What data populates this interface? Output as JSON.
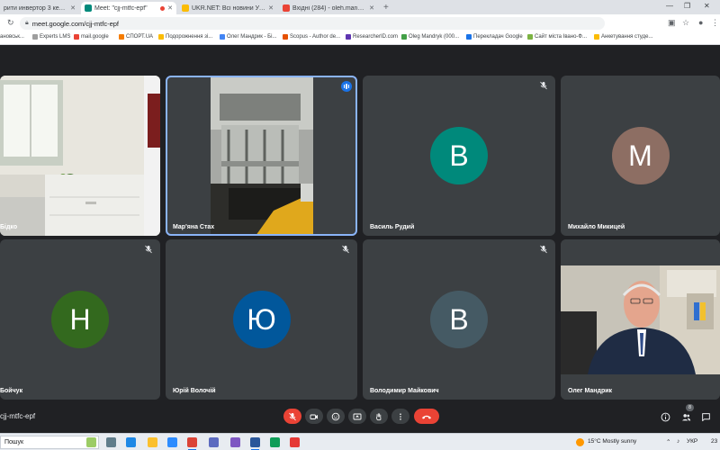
{
  "browser": {
    "tabs": [
      {
        "label": "рити инвертор 3 кет в Івано-Ф",
        "fav_color": "#4285f4"
      },
      {
        "label": "Meet: \"cjj-mtfc-epf\"",
        "fav_color": "#00897b"
      },
      {
        "label": "UKR.NET: Всі новини України, о",
        "fav_color": "#fbbc04"
      },
      {
        "label": "Вхідні (284) - oleh.mandryk@nu",
        "fav_color": "#ea4335"
      }
    ],
    "url": "meet.google.com/cjj-mtfc-epf",
    "bookmarks": [
      {
        "label": "ановськ...",
        "color": "#9e9e9e"
      },
      {
        "label": "Experts LMS",
        "color": "#ffffff"
      },
      {
        "label": "mail.google",
        "color": "#ea4335"
      },
      {
        "label": "СПОРТ.UA",
        "color": "#f57c00"
      },
      {
        "label": "Подорожнення зі...",
        "color": "#fbbc04"
      },
      {
        "label": "Олег Мандрик - Бі...",
        "color": "#4285f4"
      },
      {
        "label": "Scopus - Author de...",
        "color": "#e65100"
      },
      {
        "label": "ResearcherID.com",
        "color": "#5e35b1"
      },
      {
        "label": "Oleg Mandryk (000...",
        "color": "#43a047"
      },
      {
        "label": "Перекладач Google",
        "color": "#1a73e8"
      },
      {
        "label": "Сайт міста Івано-Ф...",
        "color": "#7cb342"
      },
      {
        "label": "Анкетування студе...",
        "color": "#fbbc04"
      }
    ]
  },
  "participants": [
    {
      "name": "Бідко",
      "type": "video-office"
    },
    {
      "name": "Мар'яна Стах",
      "type": "video-equipment",
      "speaking": true
    },
    {
      "name": "Василь Рудий",
      "initial": "В",
      "color": "#00897b"
    },
    {
      "name": "Михайло Микицей",
      "initial": "М",
      "color": "#8d6e63"
    },
    {
      "name": "Бойчук",
      "initial": "Н",
      "color": "#33691e"
    },
    {
      "name": "Юрій Волочій",
      "initial": "Ю",
      "color": "#01579b"
    },
    {
      "name": "Володимир Майкович",
      "initial": "В",
      "color": "#455a64"
    },
    {
      "name": "Олег Мандрик",
      "type": "video-person"
    }
  ],
  "meeting": {
    "code": "cjj-mtfc-epf",
    "people_count": "8"
  },
  "colors": {
    "background": "#202124",
    "tile": "#3c4043",
    "end_call": "#ea4335",
    "speaking": "#8ab4f8"
  },
  "taskbar": {
    "search": "Пошук",
    "weather": "15°C  Mostly sunny",
    "language": "УКР",
    "time": "23"
  }
}
